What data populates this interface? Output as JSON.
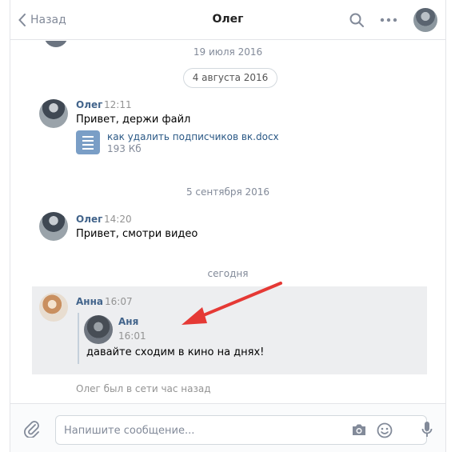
{
  "header": {
    "back_label": "Назад",
    "title": "Олег",
    "icons": [
      "chevron-left-icon",
      "search-icon",
      "more-icon"
    ]
  },
  "history": {
    "dates": {
      "d1": "19 июля 2016",
      "d2": "4 августа 2016",
      "d3": "5 сентября 2016",
      "d4": "сегодня"
    },
    "messages": [
      {
        "author": "Олег",
        "time": "12:11",
        "text": "Привет, держи файл",
        "attachment": {
          "name": "как удалить подписчиков вк.docx",
          "size": "193 Кб",
          "icon": "document-icon"
        }
      },
      {
        "author": "Олег",
        "time": "14:20",
        "text": "Привет, смотри видео"
      },
      {
        "author": "Анна",
        "time": "16:07",
        "forwarded": {
          "author": "Аня",
          "time": "16:01"
        },
        "text": "давайте сходим в кино на днях!"
      }
    ],
    "status": "Олег был в сети час назад"
  },
  "composer": {
    "placeholder": "Напишите сообщение...",
    "icons": [
      "paperclip-icon",
      "camera-icon",
      "smile-icon",
      "microphone-icon"
    ]
  },
  "colors": {
    "link": "#42648b",
    "muted": "#828a99",
    "selected_bg": "#edeef0",
    "annotation_arrow": "#e53935"
  }
}
